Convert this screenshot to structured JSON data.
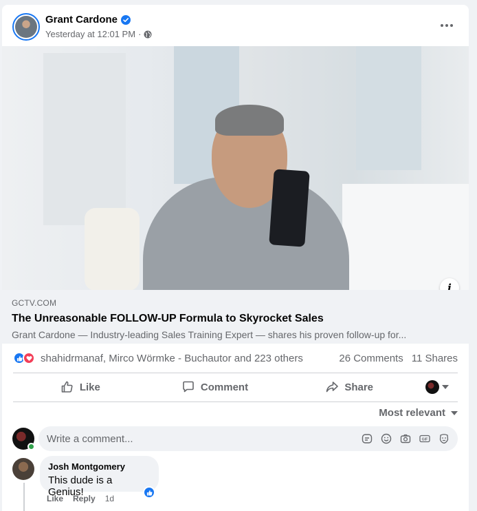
{
  "post": {
    "author": "Grant Cardone",
    "timestamp": "Yesterday at 12:01 PM",
    "separator": "·",
    "audience_icon": "globe-icon",
    "verified_icon": "verified-badge-icon"
  },
  "link": {
    "domain": "GCTV.COM",
    "title": "The Unreasonable FOLLOW-UP Formula to Skyrocket Sales",
    "description": "Grant Cardone — Industry-leading Sales Training Expert — shares his proven follow-up for..."
  },
  "reactions": {
    "names": "shahidrmanaf, Mirco Wörmke - Buchautor and 223 others",
    "comments": "26 Comments",
    "shares": "11 Shares",
    "types": [
      "like",
      "love"
    ]
  },
  "actions": {
    "like": "Like",
    "comment": "Comment",
    "share": "Share"
  },
  "sort": {
    "label": "Most relevant"
  },
  "composer": {
    "placeholder": "Write a comment...",
    "icons": [
      "sticker-icon",
      "emoji-icon",
      "camera-icon",
      "gif-icon",
      "avatar-sticker-icon"
    ]
  },
  "comments": [
    {
      "author": "Josh Montgomery",
      "text": "This dude is a Genius!",
      "like": "Like",
      "reply": "Reply",
      "age": "1d"
    }
  ],
  "colors": {
    "accent": "#1877f2",
    "love": "#f33e58",
    "muted": "#65676b",
    "surface": "#f0f2f5",
    "online": "#31a24c"
  }
}
